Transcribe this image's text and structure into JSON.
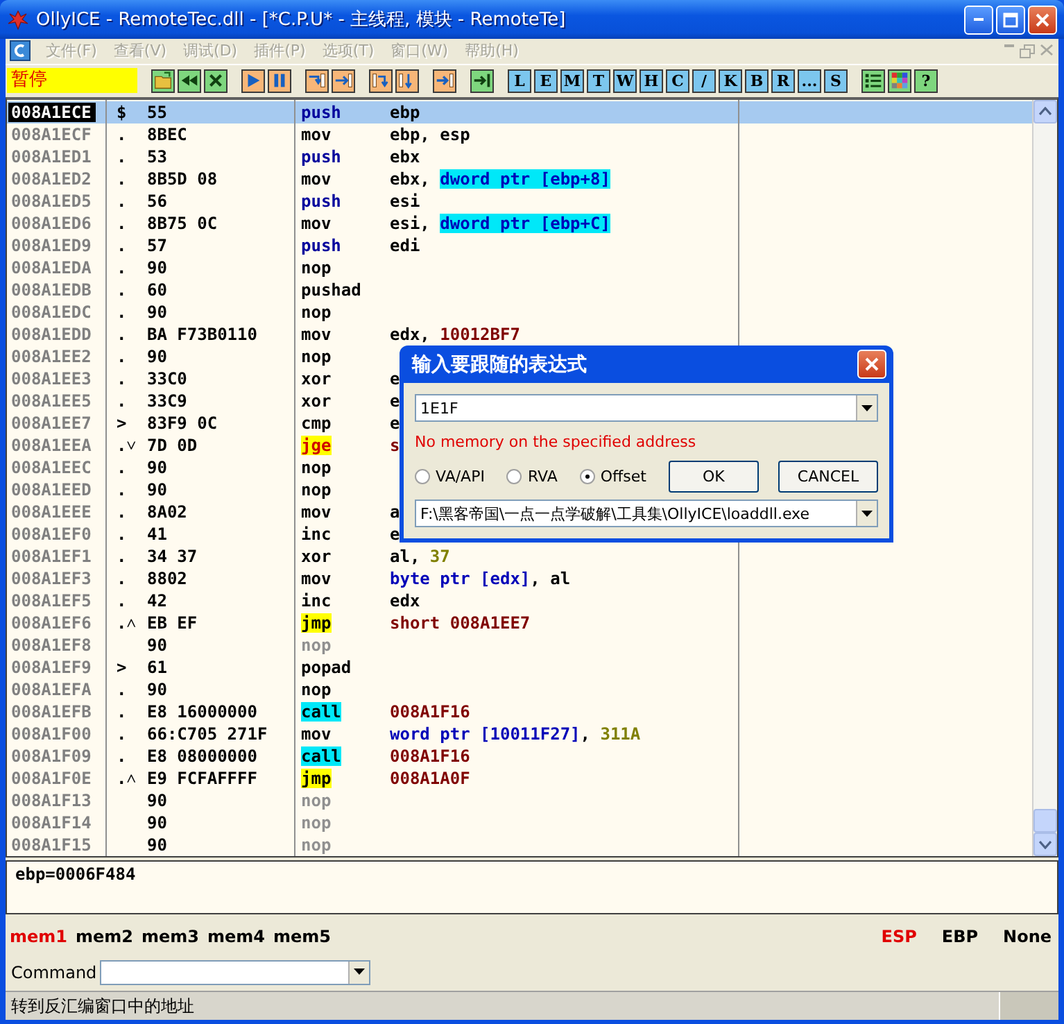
{
  "window": {
    "title": "OllyICE - RemoteTec.dll - [*C.P.U* - 主线程, 模块 - RemoteTe]"
  },
  "menu": {
    "items": [
      {
        "label": "文件(F)",
        "disabled": true
      },
      {
        "label": "查看(V)",
        "disabled": true
      },
      {
        "label": "调试(D)",
        "disabled": true
      },
      {
        "label": "插件(P)",
        "disabled": true
      },
      {
        "label": "选项(T)",
        "disabled": true
      },
      {
        "label": "窗口(W)",
        "disabled": true
      },
      {
        "label": "帮助(H)",
        "disabled": true
      }
    ]
  },
  "toolbar": {
    "status": "暂停",
    "groups": [
      [
        {
          "kind": "icon"
        },
        {
          "kind": "icon"
        },
        {
          "kind": "icon"
        }
      ],
      [
        {
          "kind": "icon"
        },
        {
          "kind": "icon"
        }
      ],
      [
        {
          "kind": "icon"
        },
        {
          "kind": "icon"
        }
      ],
      [
        {
          "kind": "icon"
        },
        {
          "kind": "icon"
        }
      ],
      [
        {
          "kind": "icon"
        }
      ],
      [
        {
          "kind": "icon"
        }
      ],
      [
        {
          "kind": "letter",
          "label": "L"
        },
        {
          "kind": "letter",
          "label": "E"
        },
        {
          "kind": "letter",
          "label": "M"
        },
        {
          "kind": "letter",
          "label": "T"
        },
        {
          "kind": "letter",
          "label": "W"
        },
        {
          "kind": "letter",
          "label": "H"
        },
        {
          "kind": "letter",
          "label": "C"
        },
        {
          "kind": "letter",
          "label": "/"
        },
        {
          "kind": "letter",
          "label": "K"
        },
        {
          "kind": "letter",
          "label": "B"
        },
        {
          "kind": "letter",
          "label": "R"
        },
        {
          "kind": "letter",
          "label": "..."
        },
        {
          "kind": "letter",
          "label": "S"
        }
      ],
      [
        {
          "kind": "icon"
        },
        {
          "kind": "icon"
        },
        {
          "kind": "help",
          "label": "?"
        }
      ]
    ]
  },
  "cpu": {
    "rows": [
      {
        "address": "008A1ECE",
        "marker": "$",
        "hex": "55",
        "mnemonic": "push",
        "kind": "push",
        "operand": [
          {
            "text": "ebp",
            "kind": "plain"
          }
        ],
        "selected": true
      },
      {
        "address": "008A1ECF",
        "marker": ".",
        "hex": "8BEC",
        "mnemonic": "mov",
        "kind": "plain",
        "operand": [
          {
            "text": "ebp, esp",
            "kind": "plain"
          }
        ],
        "selected": false
      },
      {
        "address": "008A1ED1",
        "marker": ".",
        "hex": "53",
        "mnemonic": "push",
        "kind": "push",
        "operand": [
          {
            "text": "ebx",
            "kind": "plain"
          }
        ],
        "selected": false
      },
      {
        "address": "008A1ED2",
        "marker": ".",
        "hex": "8B5D 08",
        "mnemonic": "mov",
        "kind": "plain",
        "operand": [
          {
            "text": "ebx, ",
            "kind": "plain"
          },
          {
            "text": "dword ptr [ebp+8]",
            "kind": "mem_hl"
          }
        ],
        "selected": false
      },
      {
        "address": "008A1ED5",
        "marker": ".",
        "hex": "56",
        "mnemonic": "push",
        "kind": "push",
        "operand": [
          {
            "text": "esi",
            "kind": "plain"
          }
        ],
        "selected": false
      },
      {
        "address": "008A1ED6",
        "marker": ".",
        "hex": "8B75 0C",
        "mnemonic": "mov",
        "kind": "plain",
        "operand": [
          {
            "text": "esi, ",
            "kind": "plain"
          },
          {
            "text": "dword ptr [ebp+C]",
            "kind": "mem_hl"
          }
        ],
        "selected": false
      },
      {
        "address": "008A1ED9",
        "marker": ".",
        "hex": "57",
        "mnemonic": "push",
        "kind": "push",
        "operand": [
          {
            "text": "edi",
            "kind": "plain"
          }
        ],
        "selected": false
      },
      {
        "address": "008A1EDA",
        "marker": ".",
        "hex": "90",
        "mnemonic": "nop",
        "kind": "plain",
        "operand": [],
        "selected": false
      },
      {
        "address": "008A1EDB",
        "marker": ".",
        "hex": "60",
        "mnemonic": "pushad",
        "kind": "plain",
        "operand": [],
        "selected": false
      },
      {
        "address": "008A1EDC",
        "marker": ".",
        "hex": "90",
        "mnemonic": "nop",
        "kind": "plain",
        "operand": [],
        "selected": false
      },
      {
        "address": "008A1EDD",
        "marker": ".",
        "hex": "BA F73B0110",
        "mnemonic": "mov",
        "kind": "plain",
        "operand": [
          {
            "text": "edx, ",
            "kind": "plain"
          },
          {
            "text": "10012BF7",
            "kind": "addr"
          }
        ],
        "selected": false
      },
      {
        "address": "008A1EE2",
        "marker": ".",
        "hex": "90",
        "mnemonic": "nop",
        "kind": "plain",
        "operand": [],
        "selected": false
      },
      {
        "address": "008A1EE3",
        "marker": ".",
        "hex": "33C0",
        "mnemonic": "xor",
        "kind": "plain",
        "operand": [
          {
            "text": "e",
            "kind": "plain"
          }
        ],
        "selected": false
      },
      {
        "address": "008A1EE5",
        "marker": ".",
        "hex": "33C9",
        "mnemonic": "xor",
        "kind": "plain",
        "operand": [
          {
            "text": "e",
            "kind": "plain"
          }
        ],
        "selected": false
      },
      {
        "address": "008A1EE7",
        "marker": ">",
        "hex": "83F9 0C",
        "mnemonic": "cmp",
        "kind": "plain",
        "operand": [
          {
            "text": "e",
            "kind": "plain"
          }
        ],
        "selected": false
      },
      {
        "address": "008A1EEA",
        "marker": ".˅",
        "hex": "7D 0D",
        "mnemonic": "jge",
        "kind": "cond_jump",
        "operand": [
          {
            "text": "s",
            "kind": "addr"
          }
        ],
        "selected": false
      },
      {
        "address": "008A1EEC",
        "marker": ".",
        "hex": "90",
        "mnemonic": "nop",
        "kind": "plain",
        "operand": [],
        "selected": false
      },
      {
        "address": "008A1EED",
        "marker": ".",
        "hex": "90",
        "mnemonic": "nop",
        "kind": "plain",
        "operand": [],
        "selected": false
      },
      {
        "address": "008A1EEE",
        "marker": ".",
        "hex": "8A02",
        "mnemonic": "mov",
        "kind": "plain",
        "operand": [
          {
            "text": "a",
            "kind": "plain"
          }
        ],
        "selected": false
      },
      {
        "address": "008A1EF0",
        "marker": ".",
        "hex": "41",
        "mnemonic": "inc",
        "kind": "plain",
        "operand": [
          {
            "text": "e",
            "kind": "plain"
          }
        ],
        "selected": false
      },
      {
        "address": "008A1EF1",
        "marker": ".",
        "hex": "34 37",
        "mnemonic": "xor",
        "kind": "plain",
        "operand": [
          {
            "text": "al, ",
            "kind": "plain"
          },
          {
            "text": "37",
            "kind": "const"
          }
        ],
        "selected": false
      },
      {
        "address": "008A1EF3",
        "marker": ".",
        "hex": "8802",
        "mnemonic": "mov",
        "kind": "plain",
        "operand": [
          {
            "text": "byte ptr [edx]",
            "kind": "mem"
          },
          {
            "text": ", al",
            "kind": "plain"
          }
        ],
        "selected": false
      },
      {
        "address": "008A1EF5",
        "marker": ".",
        "hex": "42",
        "mnemonic": "inc",
        "kind": "plain",
        "operand": [
          {
            "text": "edx",
            "kind": "plain"
          }
        ],
        "selected": false
      },
      {
        "address": "008A1EF6",
        "marker": ".˄",
        "hex": "EB EF",
        "mnemonic": "jmp",
        "kind": "jump",
        "operand": [
          {
            "text": "short 008A1EE7",
            "kind": "addr"
          }
        ],
        "selected": false
      },
      {
        "address": "008A1EF8",
        "marker": "",
        "hex": "90",
        "mnemonic": "nop",
        "kind": "dead",
        "operand": [],
        "selected": false
      },
      {
        "address": "008A1EF9",
        "marker": ">",
        "hex": "61",
        "mnemonic": "popad",
        "kind": "plain",
        "operand": [],
        "selected": false
      },
      {
        "address": "008A1EFA",
        "marker": ".",
        "hex": "90",
        "mnemonic": "nop",
        "kind": "plain",
        "operand": [],
        "selected": false
      },
      {
        "address": "008A1EFB",
        "marker": ".",
        "hex": "E8 16000000",
        "mnemonic": "call",
        "kind": "call",
        "operand": [
          {
            "text": "008A1F16",
            "kind": "addr"
          }
        ],
        "selected": false
      },
      {
        "address": "008A1F00",
        "marker": ".",
        "hex": "66:C705 271F",
        "mnemonic": "mov",
        "kind": "plain",
        "operand": [
          {
            "text": "word ptr [10011F27]",
            "kind": "mem"
          },
          {
            "text": ", ",
            "kind": "plain"
          },
          {
            "text": "311A",
            "kind": "const"
          }
        ],
        "selected": false
      },
      {
        "address": "008A1F09",
        "marker": ".",
        "hex": "E8 08000000",
        "mnemonic": "call",
        "kind": "call",
        "operand": [
          {
            "text": "008A1F16",
            "kind": "addr"
          }
        ],
        "selected": false
      },
      {
        "address": "008A1F0E",
        "marker": ".˄",
        "hex": "E9 FCFAFFFF",
        "mnemonic": "jmp",
        "kind": "jump",
        "operand": [
          {
            "text": "008A1A0F",
            "kind": "addr"
          }
        ],
        "selected": false
      },
      {
        "address": "008A1F13",
        "marker": "",
        "hex": "90",
        "mnemonic": "nop",
        "kind": "dead",
        "operand": [],
        "selected": false
      },
      {
        "address": "008A1F14",
        "marker": "",
        "hex": "90",
        "mnemonic": "nop",
        "kind": "dead",
        "operand": [],
        "selected": false
      },
      {
        "address": "008A1F15",
        "marker": "",
        "hex": "90",
        "mnemonic": "nop",
        "kind": "dead",
        "operand": [],
        "selected": false
      }
    ],
    "info": "ebp=0006F484"
  },
  "dialog": {
    "title": "输入要跟随的表达式",
    "expression": "1E1F",
    "error": "No memory on the specified address",
    "options": [
      {
        "label": "VA/API",
        "selected": false
      },
      {
        "label": "RVA",
        "selected": false
      },
      {
        "label": "Offset",
        "selected": true
      }
    ],
    "buttons": [
      "OK",
      "CANCEL"
    ],
    "path": "F:\\黑客帝国\\一点一点学破解\\工具集\\OllyICE\\loaddll.exe"
  },
  "dump_tabs": [
    {
      "label": "mem1",
      "selected": true
    },
    {
      "label": "mem2",
      "selected": false
    },
    {
      "label": "mem3",
      "selected": false
    },
    {
      "label": "mem4",
      "selected": false
    },
    {
      "label": "mem5",
      "selected": false
    }
  ],
  "stack_tabs": [
    {
      "label": "ESP",
      "selected": true
    },
    {
      "label": "EBP",
      "selected": false
    },
    {
      "label": "None",
      "selected": false
    }
  ],
  "command": {
    "label": "Command"
  },
  "status_bar": "转到反汇编窗口中的地址"
}
